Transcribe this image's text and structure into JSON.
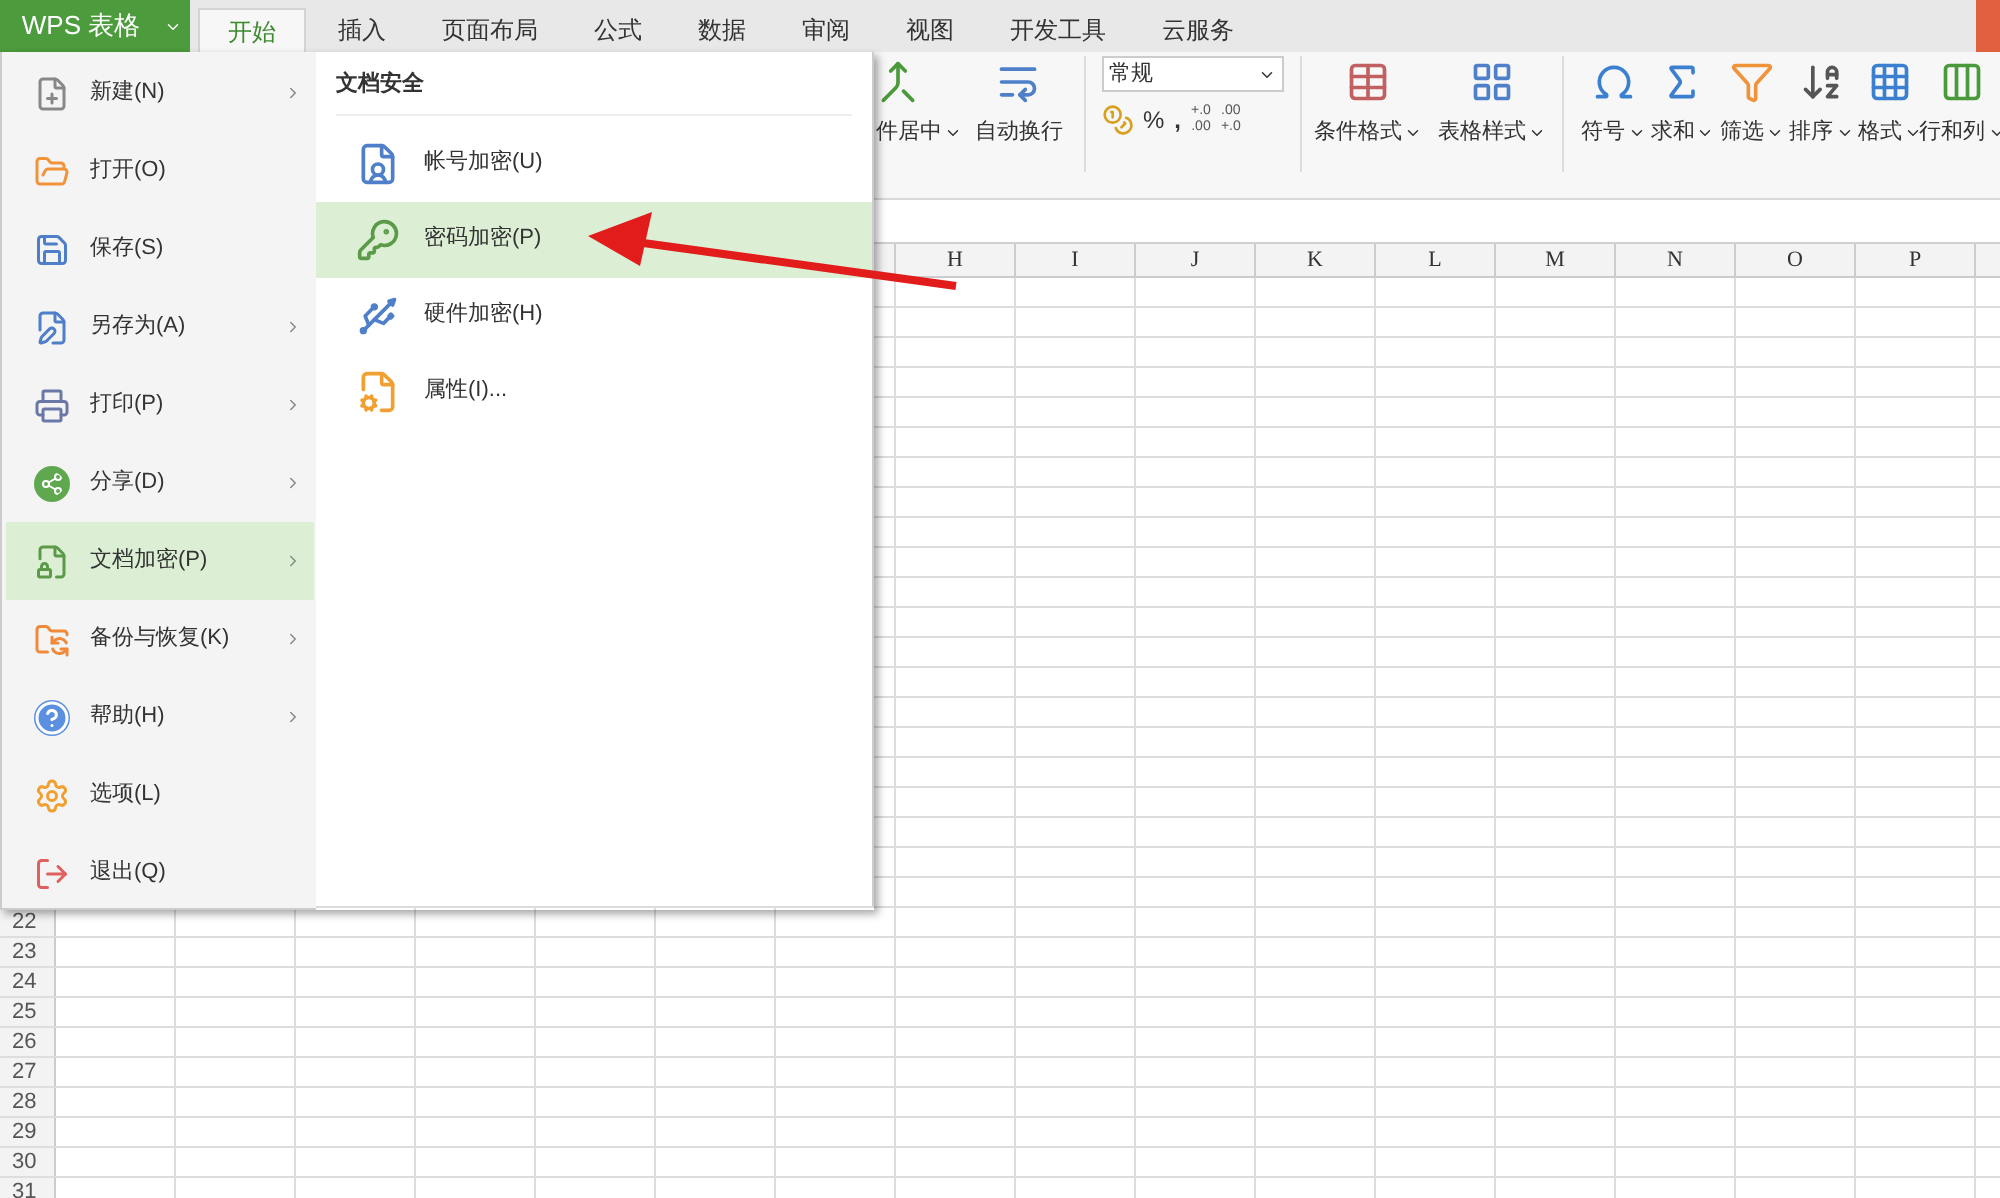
{
  "app_button": {
    "label": "WPS 表格"
  },
  "tabs": [
    {
      "label": "开始",
      "selected": true
    },
    {
      "label": "插入",
      "selected": false
    },
    {
      "label": "页面布局",
      "selected": false
    },
    {
      "label": "公式",
      "selected": false
    },
    {
      "label": "数据",
      "selected": false
    },
    {
      "label": "审阅",
      "selected": false
    },
    {
      "label": "视图",
      "selected": false
    },
    {
      "label": "开发工具",
      "selected": false
    },
    {
      "label": "云服务",
      "selected": false
    }
  ],
  "ribbon": {
    "alignment": [
      {
        "label": "件居中"
      },
      {
        "label": "自动换行"
      }
    ],
    "number_format": {
      "value": "常规",
      "percent": "%",
      "comma": ",",
      "decimals": [
        {
          "top": "+.0",
          "bottom": ".00"
        },
        {
          "top": ".00",
          "bottom": "+.0"
        }
      ]
    },
    "styles": [
      {
        "label": "条件格式"
      },
      {
        "label": "表格样式"
      }
    ],
    "editing": [
      {
        "label": "符号"
      },
      {
        "label": "求和"
      },
      {
        "label": "筛选"
      },
      {
        "label": "排序"
      },
      {
        "label": "格式"
      },
      {
        "label": "行和列"
      }
    ]
  },
  "grid": {
    "columns": [
      "H",
      "I",
      "J",
      "K",
      "L",
      "M",
      "N",
      "O",
      "P"
    ],
    "rows": [
      "22",
      "23",
      "24",
      "25",
      "26",
      "27",
      "28",
      "29",
      "30",
      "31"
    ]
  },
  "file_menu": {
    "items": [
      {
        "label": "新建(N)",
        "has_submenu": true,
        "selected": false
      },
      {
        "label": "打开(O)",
        "has_submenu": false,
        "selected": false
      },
      {
        "label": "保存(S)",
        "has_submenu": false,
        "selected": false
      },
      {
        "label": "另存为(A)",
        "has_submenu": true,
        "selected": false
      },
      {
        "label": "打印(P)",
        "has_submenu": true,
        "selected": false
      },
      {
        "label": "分享(D)",
        "has_submenu": true,
        "selected": false
      },
      {
        "label": "文档加密(P)",
        "has_submenu": true,
        "selected": true
      },
      {
        "label": "备份与恢复(K)",
        "has_submenu": true,
        "selected": false
      },
      {
        "label": "帮助(H)",
        "has_submenu": true,
        "selected": false
      },
      {
        "label": "选项(L)",
        "has_submenu": false,
        "selected": false
      },
      {
        "label": "退出(Q)",
        "has_submenu": false,
        "selected": false
      }
    ]
  },
  "submenu": {
    "heading": "文档安全",
    "items": [
      {
        "label": "帐号加密(U)",
        "selected": false
      },
      {
        "label": "密码加密(P)",
        "selected": true
      },
      {
        "label": "硬件加密(H)",
        "selected": false
      },
      {
        "label": "属性(I)...",
        "selected": false
      }
    ]
  }
}
